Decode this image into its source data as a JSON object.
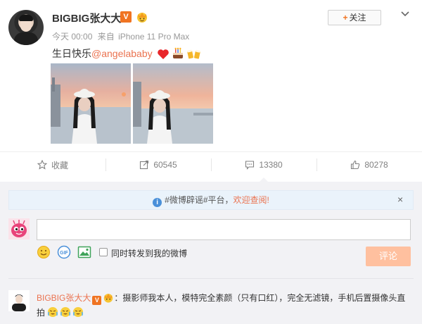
{
  "post": {
    "username": "BIGBIG张大大",
    "verified_badge": "V",
    "timestamp": "今天 00:00",
    "source_prefix": "来自",
    "source_device": "iPhone 11 Pro Max",
    "follow_label": "关注",
    "text_prefix": "生日快乐",
    "mention": "@angelababy",
    "text_emojis": [
      "red-heart",
      "birthday-cake",
      "beer-cheers"
    ],
    "photos": [
      "photo-1",
      "photo-2"
    ]
  },
  "actions": {
    "favorite_label": "收藏",
    "repost_count": "60545",
    "comment_count": "13380",
    "like_count": "80278"
  },
  "comment_box": {
    "notice_prefix": "#微博辟谣#平台，",
    "notice_highlight": "欢迎查阅!",
    "close_symbol": "×",
    "input_value": "",
    "repost_checkbox_label": "同时转发到我的微博",
    "submit_label": "评论",
    "gif_label": "GIF"
  },
  "comments": [
    {
      "user": "BIGBIG张大大",
      "badge": "V",
      "separator": "：",
      "text": "摄影师我本人，模特完全素颜（只有口红），完全无滤镜，手机后置摄像头直拍"
    }
  ],
  "colors": {
    "accent": "#eb7350",
    "badge_orange": "#f07422",
    "submit_disabled": "#ffc09f",
    "comment_bg": "#f2f2f5",
    "notice_bg": "#eaf3fb"
  }
}
